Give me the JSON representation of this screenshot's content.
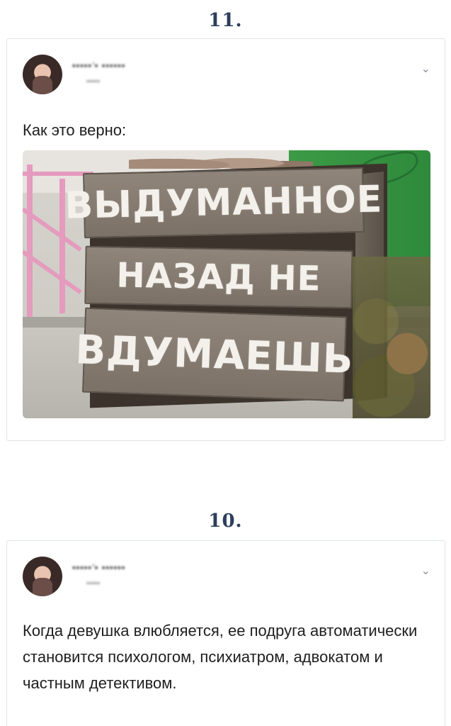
{
  "posts": [
    {
      "number": "11.",
      "author": {
        "name": "•••••’• ••••••",
        "handle": "•••••"
      },
      "text": "Как это верно:",
      "image": {
        "sign_lines": [
          "ВЫДУМАННОЕ",
          "НАЗАД НЕ",
          "ВДУМАЕШЬ"
        ]
      },
      "menu_icon": "chevron-down-icon"
    },
    {
      "number": "10.",
      "author": {
        "name": "•••••’• ••••••",
        "handle": "•••••"
      },
      "text": "Когда девушка влюбляется, ее подруга автоматически становится психологом, психиатром, адвокатом и частным детективом.",
      "menu_icon": "chevron-down-icon"
    }
  ],
  "colors": {
    "number": "#2c3e5a",
    "card_border": "#dfe3e8",
    "chevron": "#8a8f99"
  }
}
